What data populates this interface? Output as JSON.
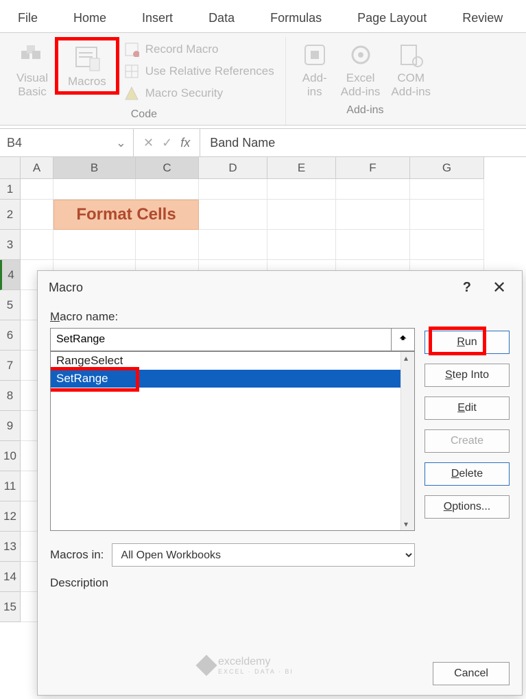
{
  "tabs": [
    "File",
    "Home",
    "Insert",
    "Data",
    "Formulas",
    "Page Layout",
    "Review"
  ],
  "ribbon": {
    "code": {
      "visualBasic": "Visual\nBasic",
      "macros": "Macros",
      "recordMacro": "Record Macro",
      "useRelative": "Use Relative References",
      "macroSecurity": "Macro Security",
      "groupLabel": "Code"
    },
    "addins": {
      "addIns": "Add-\nins",
      "excelAddIns": "Excel\nAdd-ins",
      "comAddIns": "COM\nAdd-ins",
      "groupLabel": "Add-ins"
    }
  },
  "nameBox": "B4",
  "formulaValue": "Band Name",
  "columns": [
    "A",
    "B",
    "C",
    "D",
    "E",
    "F",
    "G"
  ],
  "rows": [
    "1",
    "2",
    "3",
    "4",
    "5",
    "6",
    "7",
    "8",
    "9",
    "10",
    "11",
    "12",
    "13",
    "14",
    "15"
  ],
  "titleCell": "Format Cells",
  "dialog": {
    "title": "Macro",
    "macroNameLabelPre": "M",
    "macroNameLabelRest": "acro name:",
    "macroNameValue": "SetRange",
    "listItems": [
      "RangeSelect",
      "SetRange"
    ],
    "selectedIndex": 1,
    "macrosInLabel": "Macros in:",
    "macrosInValue": "All Open Workbooks",
    "descriptionLabel": "Description",
    "buttons": {
      "run": "Run",
      "stepInto": "Step Into",
      "edit": "Edit",
      "create": "Create",
      "delete": "Delete",
      "options": "Options...",
      "cancel": "Cancel"
    }
  },
  "watermark": {
    "brand": "exceldemy",
    "tag": "EXCEL · DATA · BI"
  }
}
